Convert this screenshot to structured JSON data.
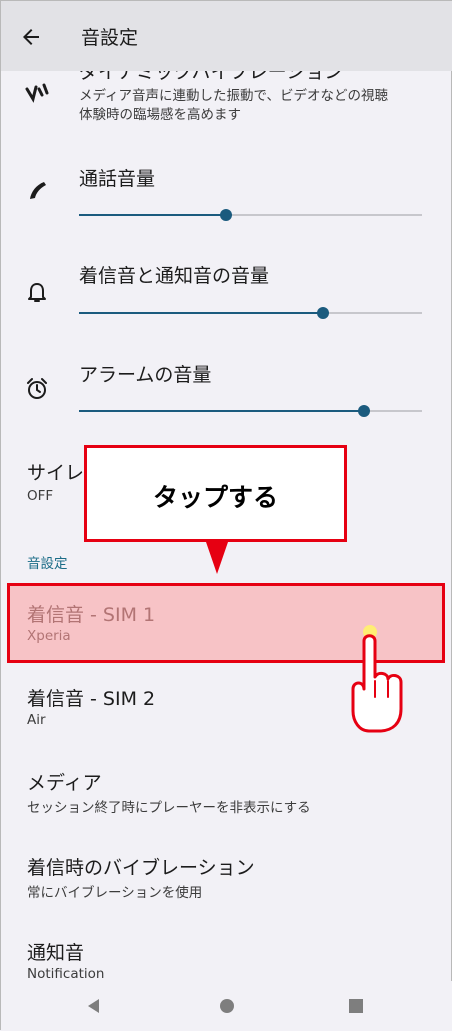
{
  "appbar": {
    "back_icon": "arrow-back-icon",
    "title": "音設定"
  },
  "dynamic_vibration": {
    "title": "ダイナミックバイブレーション",
    "subtitle_line1": "メディア音声に連動した振動で、ビデオなどの視聴",
    "subtitle_line2": "体験時の臨場感を高めます"
  },
  "call_volume": {
    "title": "通話音量",
    "level_percent": 43
  },
  "ring_notification_volume": {
    "title": "着信音と通知音の音量",
    "level_percent": 71
  },
  "alarm_volume": {
    "title": "アラームの音量",
    "level_percent": 83
  },
  "silent_mode": {
    "title": "サイレントモード",
    "value": "OFF"
  },
  "section_header": "音設定",
  "ringtone_sim1": {
    "title": "着信音 - SIM 1",
    "value": "Xperia"
  },
  "ringtone_sim2": {
    "title": "着信音 - SIM 2",
    "value": "Air"
  },
  "media": {
    "title": "メディア",
    "subtitle": "セッション終了時にプレーヤーを非表示にする"
  },
  "vibrate_on_ring": {
    "title": "着信時のバイブレーション",
    "subtitle": "常にバイブレーションを使用"
  },
  "notification_sound": {
    "title": "通知音",
    "value": "Notification"
  },
  "annotation": {
    "callout_text": "タップする"
  },
  "colors": {
    "accent": "#1b5b7e",
    "annotation_red": "#e60012",
    "background": "#f2f1f6"
  },
  "navbar": {
    "back": "nav-back-icon",
    "home": "nav-home-icon",
    "recents": "nav-recents-icon"
  }
}
